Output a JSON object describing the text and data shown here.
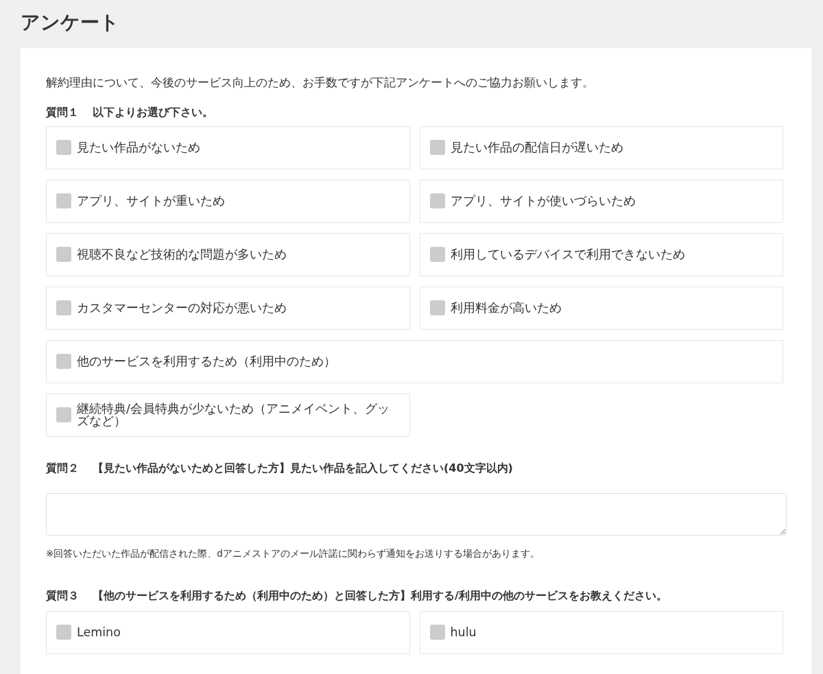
{
  "title": "アンケート",
  "intro": "解約理由について、今後のサービス向上のため、お手数ですが下記アンケートへのご協力お願いします。",
  "question1": {
    "number": "質問１",
    "text": "以下よりお選び下さい。",
    "options": [
      {
        "label": "見たい作品がないため",
        "checked": false,
        "kind": "half"
      },
      {
        "label": "見たい作品の配信日が遅いため",
        "checked": false,
        "kind": "half"
      },
      {
        "label": "アプリ、サイトが重いため",
        "checked": false,
        "kind": "half"
      },
      {
        "label": "アプリ、サイトが使いづらいため",
        "checked": false,
        "kind": "half"
      },
      {
        "label": "視聴不良など技術的な問題が多いため",
        "checked": false,
        "kind": "half"
      },
      {
        "label": "利用しているデバイスで利用できないため",
        "checked": false,
        "kind": "half"
      },
      {
        "label": "カスタマーセンターの対応が悪いため",
        "checked": false,
        "kind": "half"
      },
      {
        "label": "利用料金が高いため",
        "checked": false,
        "kind": "half"
      },
      {
        "label": "他のサービスを利用するため（利用中のため）",
        "checked": false,
        "kind": "wide"
      },
      {
        "label": "継続特典/会員特典が少ないため（アニメイベント、グッズなど）",
        "checked": false,
        "kind": "half"
      }
    ]
  },
  "question2": {
    "number": "質問２",
    "text": "【見たい作品がないためと回答した方】見たい作品を記入してください(40文字以内)",
    "note": "※回答いただいた作品が配信された際、dアニメストアのメール許諾に関わらず通知をお送りする場合があります。"
  },
  "question3": {
    "number": "質問３",
    "text": "【他のサービスを利用するため（利用中のため）と回答した方】利用する/利用中の他のサービスをお教えください。",
    "options": [
      {
        "label": "Lemino",
        "checked": false
      },
      {
        "label": "hulu",
        "checked": false
      }
    ]
  }
}
